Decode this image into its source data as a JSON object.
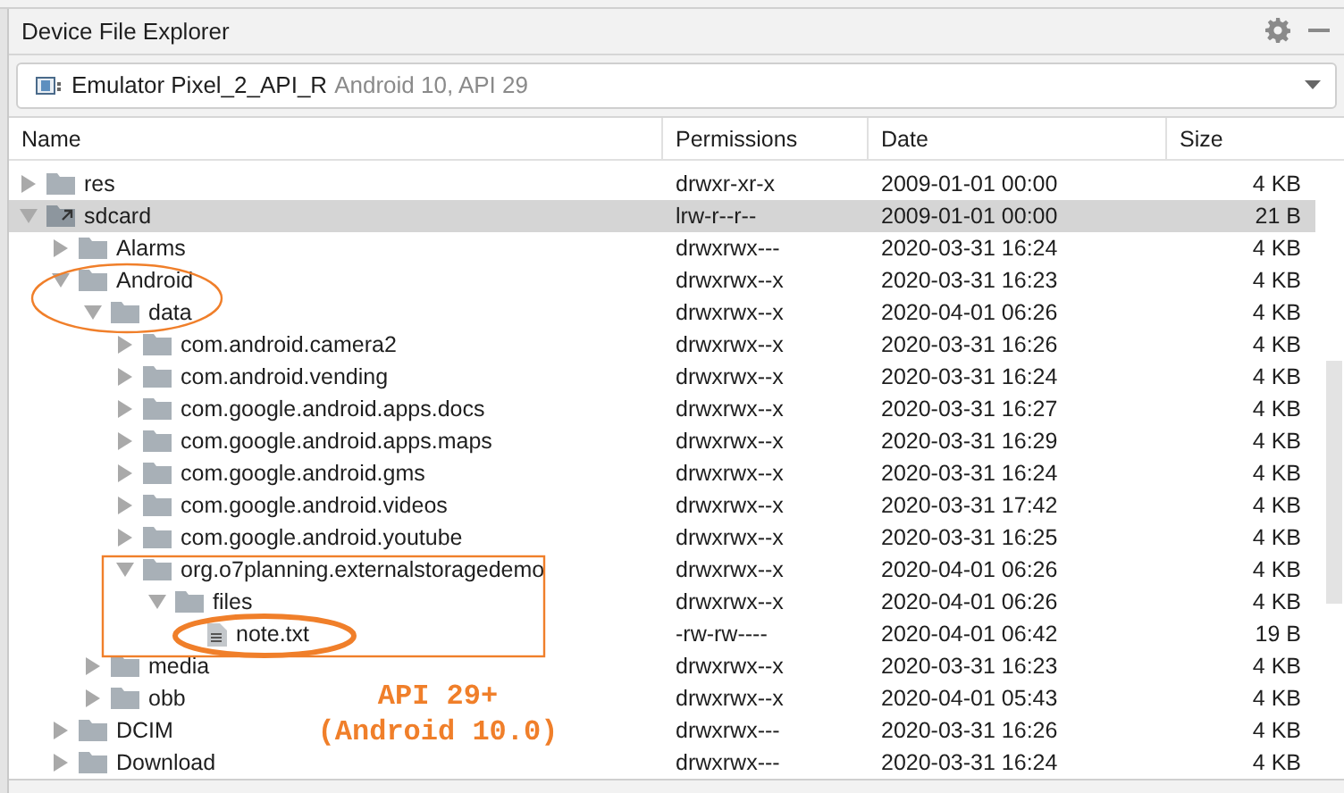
{
  "panel": {
    "title": "Device File Explorer"
  },
  "device": {
    "name": "Emulator Pixel_2_API_R",
    "detail": "Android 10, API 29"
  },
  "table": {
    "columns": [
      "Name",
      "Permissions",
      "Date",
      "Size"
    ],
    "rows": [
      {
        "name": "res",
        "kind": "folder",
        "expanded": false,
        "selected": false,
        "permissions": "drwxr-xr-x",
        "date": "2009-01-01 00:00",
        "size": "4 KB"
      },
      {
        "name": "sdcard",
        "kind": "link",
        "expanded": true,
        "selected": true,
        "permissions": "lrw-r--r--",
        "date": "2009-01-01 00:00",
        "size": "21 B",
        "children": [
          {
            "name": "Alarms",
            "kind": "folder",
            "expanded": false,
            "selected": false,
            "permissions": "drwxrwx---",
            "date": "2020-03-31 16:24",
            "size": "4 KB"
          },
          {
            "name": "Android",
            "kind": "folder",
            "expanded": true,
            "selected": false,
            "permissions": "drwxrwx--x",
            "date": "2020-03-31 16:23",
            "size": "4 KB",
            "children": [
              {
                "name": "data",
                "kind": "folder",
                "expanded": true,
                "selected": false,
                "permissions": "drwxrwx--x",
                "date": "2020-04-01 06:26",
                "size": "4 KB",
                "children": [
                  {
                    "name": "com.android.camera2",
                    "kind": "folder",
                    "expanded": false,
                    "selected": false,
                    "permissions": "drwxrwx--x",
                    "date": "2020-03-31 16:26",
                    "size": "4 KB"
                  },
                  {
                    "name": "com.android.vending",
                    "kind": "folder",
                    "expanded": false,
                    "selected": false,
                    "permissions": "drwxrwx--x",
                    "date": "2020-03-31 16:24",
                    "size": "4 KB"
                  },
                  {
                    "name": "com.google.android.apps.docs",
                    "kind": "folder",
                    "expanded": false,
                    "selected": false,
                    "permissions": "drwxrwx--x",
                    "date": "2020-03-31 16:27",
                    "size": "4 KB"
                  },
                  {
                    "name": "com.google.android.apps.maps",
                    "kind": "folder",
                    "expanded": false,
                    "selected": false,
                    "permissions": "drwxrwx--x",
                    "date": "2020-03-31 16:29",
                    "size": "4 KB"
                  },
                  {
                    "name": "com.google.android.gms",
                    "kind": "folder",
                    "expanded": false,
                    "selected": false,
                    "permissions": "drwxrwx--x",
                    "date": "2020-03-31 16:24",
                    "size": "4 KB"
                  },
                  {
                    "name": "com.google.android.videos",
                    "kind": "folder",
                    "expanded": false,
                    "selected": false,
                    "permissions": "drwxrwx--x",
                    "date": "2020-03-31 17:42",
                    "size": "4 KB"
                  },
                  {
                    "name": "com.google.android.youtube",
                    "kind": "folder",
                    "expanded": false,
                    "selected": false,
                    "permissions": "drwxrwx--x",
                    "date": "2020-03-31 16:25",
                    "size": "4 KB"
                  },
                  {
                    "name": "org.o7planning.externalstoragedemo",
                    "kind": "folder",
                    "expanded": true,
                    "selected": false,
                    "permissions": "drwxrwx--x",
                    "date": "2020-04-01 06:26",
                    "size": "4 KB",
                    "children": [
                      {
                        "name": "files",
                        "kind": "folder",
                        "expanded": true,
                        "selected": false,
                        "permissions": "drwxrwx--x",
                        "date": "2020-04-01 06:26",
                        "size": "4 KB",
                        "children": [
                          {
                            "name": "note.txt",
                            "kind": "file",
                            "selected": false,
                            "permissions": "-rw-rw----",
                            "date": "2020-04-01 06:42",
                            "size": "19 B"
                          }
                        ]
                      }
                    ]
                  }
                ]
              },
              {
                "name": "media",
                "kind": "folder",
                "expanded": false,
                "selected": false,
                "permissions": "drwxrwx--x",
                "date": "2020-03-31 16:23",
                "size": "4 KB"
              },
              {
                "name": "obb",
                "kind": "folder",
                "expanded": false,
                "selected": false,
                "permissions": "drwxrwx--x",
                "date": "2020-04-01 05:43",
                "size": "4 KB"
              }
            ]
          },
          {
            "name": "DCIM",
            "kind": "folder",
            "expanded": false,
            "selected": false,
            "permissions": "drwxrwx---",
            "date": "2020-03-31 16:26",
            "size": "4 KB"
          },
          {
            "name": "Download",
            "kind": "folder",
            "expanded": false,
            "selected": false,
            "permissions": "drwxrwx---",
            "date": "2020-03-31 16:24",
            "size": "4 KB"
          }
        ]
      }
    ]
  },
  "annotation": {
    "lines": [
      "API 29+",
      "(Android 10.0)"
    ]
  }
}
